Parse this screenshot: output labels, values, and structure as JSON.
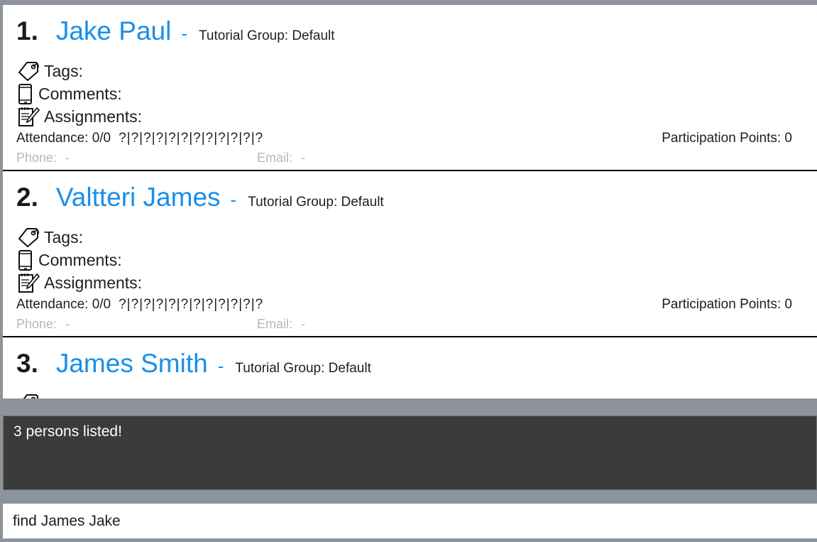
{
  "persons": [
    {
      "index": "1.",
      "name": "Jake Paul",
      "separator": "-",
      "tutorial_group": "Tutorial Group: Default",
      "tags_label": "Tags:",
      "comments_label": "Comments:",
      "assignments_label": "Assignments:",
      "attendance": "Attendance: 0/0",
      "attendance_slots": "?|?|?|?|?|?|?|?|?|?|?|?",
      "participation": "Participation Points: 0",
      "phone_label": "Phone:",
      "phone_value": "-",
      "email_label": "Email:",
      "email_value": "-"
    },
    {
      "index": "2.",
      "name": "Valtteri James",
      "separator": "-",
      "tutorial_group": "Tutorial Group: Default",
      "tags_label": "Tags:",
      "comments_label": "Comments:",
      "assignments_label": "Assignments:",
      "attendance": "Attendance: 0/0",
      "attendance_slots": "?|?|?|?|?|?|?|?|?|?|?|?",
      "participation": "Participation Points: 0",
      "phone_label": "Phone:",
      "phone_value": "-",
      "email_label": "Email:",
      "email_value": "-"
    },
    {
      "index": "3.",
      "name": "James Smith",
      "separator": "-",
      "tutorial_group": "Tutorial Group: Default"
    }
  ],
  "result_display": {
    "message": "3 persons listed!"
  },
  "command_box": {
    "value": "find James Jake"
  },
  "icons": {
    "tags": "tag-icon",
    "comments": "phone-icon",
    "assignments": "notepad-icon"
  },
  "colors": {
    "name_accent": "#1a8fe8",
    "result_bg": "#3b3b3b",
    "app_bg": "#8d939a"
  }
}
